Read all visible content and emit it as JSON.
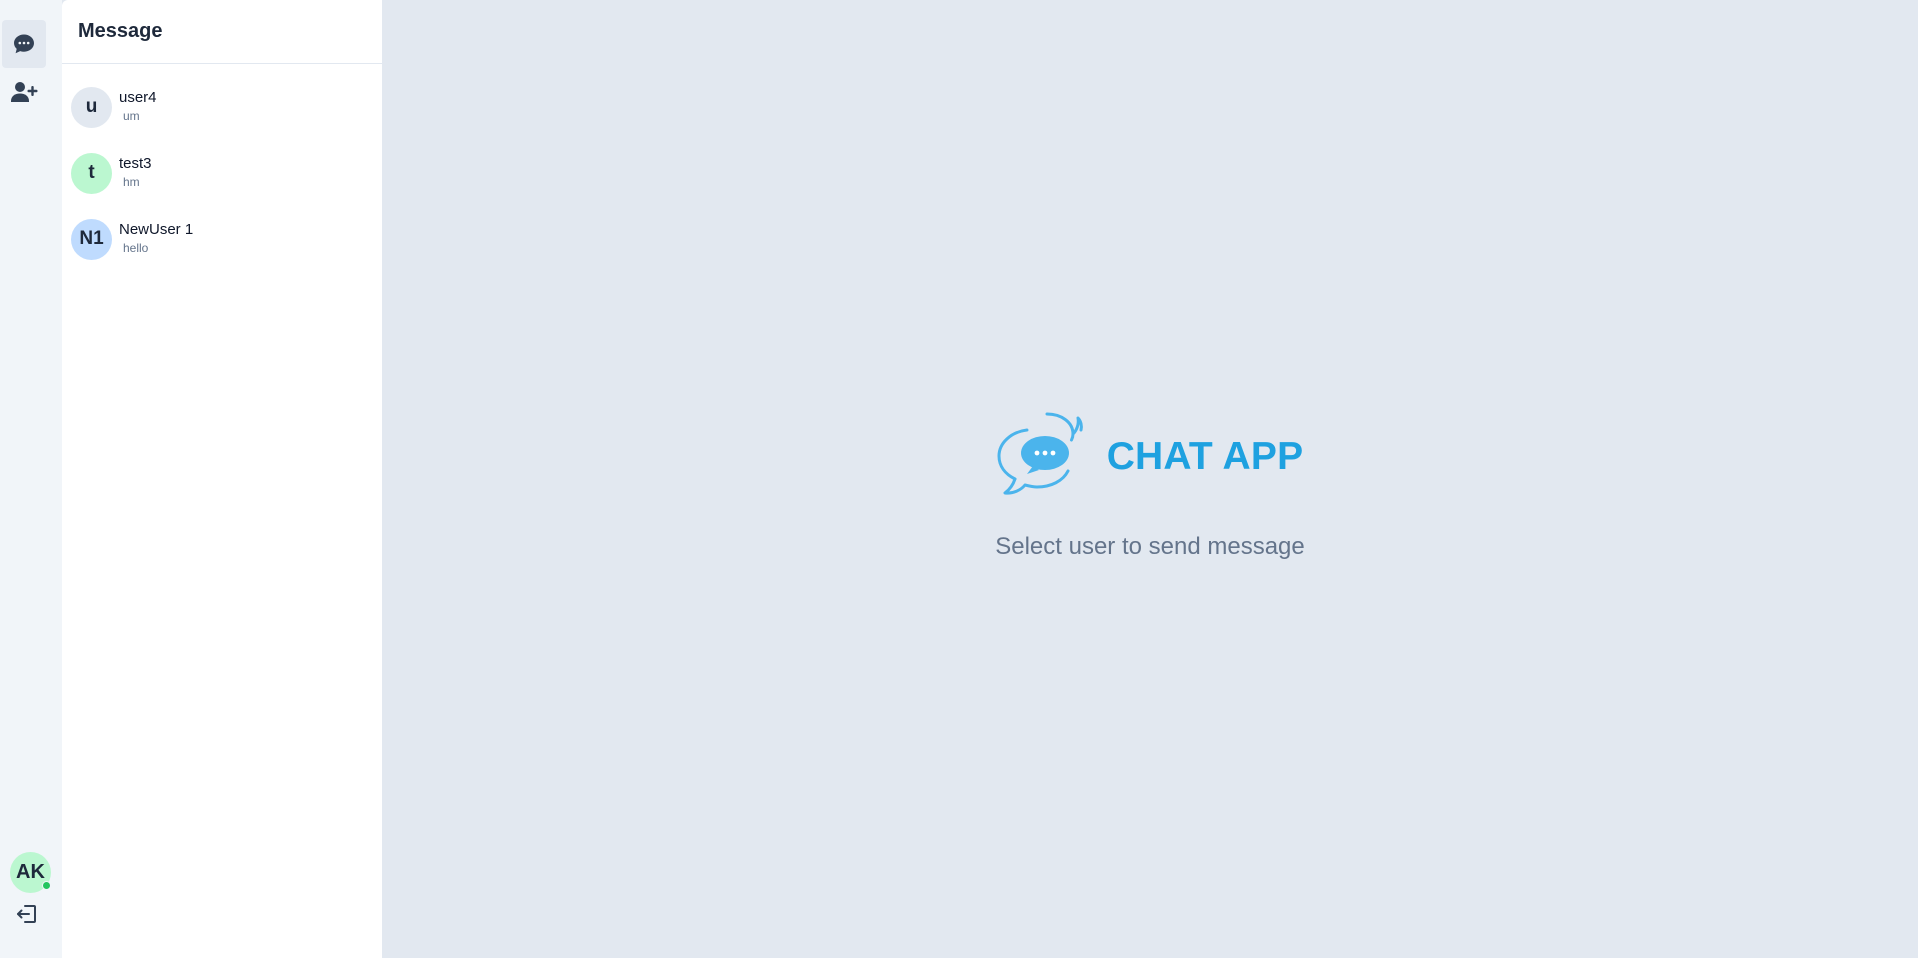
{
  "sidebar": {
    "items": [
      {
        "icon": "chat-bubble-icon",
        "active": true
      },
      {
        "icon": "add-user-icon",
        "active": false
      }
    ],
    "current_user": {
      "initials": "AK",
      "status": "online",
      "avatar_color": "#bbf7d0"
    },
    "logout_icon": "logout-icon"
  },
  "conversations": {
    "title": "Message",
    "items": [
      {
        "initials": "u",
        "name": "user4",
        "last_message": "um",
        "avatar_color": "#e2e8f0"
      },
      {
        "initials": "t",
        "name": "test3",
        "last_message": "hm",
        "avatar_color": "#bbf7d0"
      },
      {
        "initials": "N1",
        "name": "NewUser 1",
        "last_message": "hello",
        "avatar_color": "#bfdbfe"
      }
    ]
  },
  "main": {
    "brand_name": "CHAT APP",
    "hint": "Select user to send message",
    "accent": "#1ea1e0"
  }
}
